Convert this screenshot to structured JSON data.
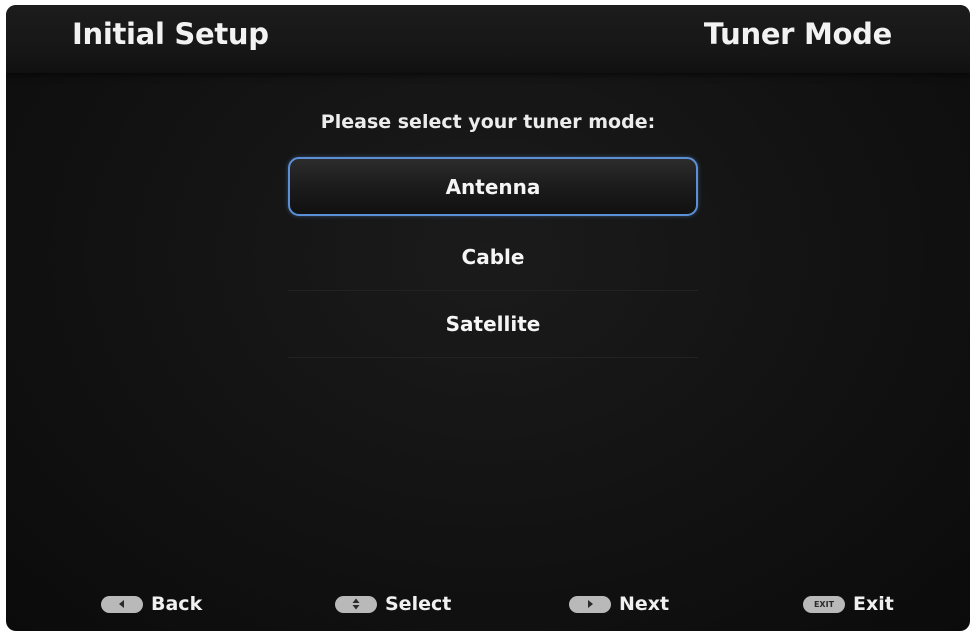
{
  "header": {
    "title": "Initial Setup",
    "screen_name": "Tuner Mode"
  },
  "prompt": "Please select your tuner mode:",
  "options": [
    {
      "label": "Antenna",
      "selected": true
    },
    {
      "label": "Cable",
      "selected": false
    },
    {
      "label": "Satellite",
      "selected": false
    }
  ],
  "footer": {
    "back": {
      "label": "Back",
      "icon": "left-arrow-icon"
    },
    "select": {
      "label": "Select",
      "icon": "up-down-arrow-icon"
    },
    "next": {
      "label": "Next",
      "icon": "right-arrow-icon"
    },
    "exit": {
      "label": "Exit",
      "icon": "exit-key-icon",
      "key_text": "EXIT"
    }
  },
  "colors": {
    "selection_border": "#5b8fd6",
    "background": "#141414",
    "key_pill": "#b9b9b9"
  }
}
